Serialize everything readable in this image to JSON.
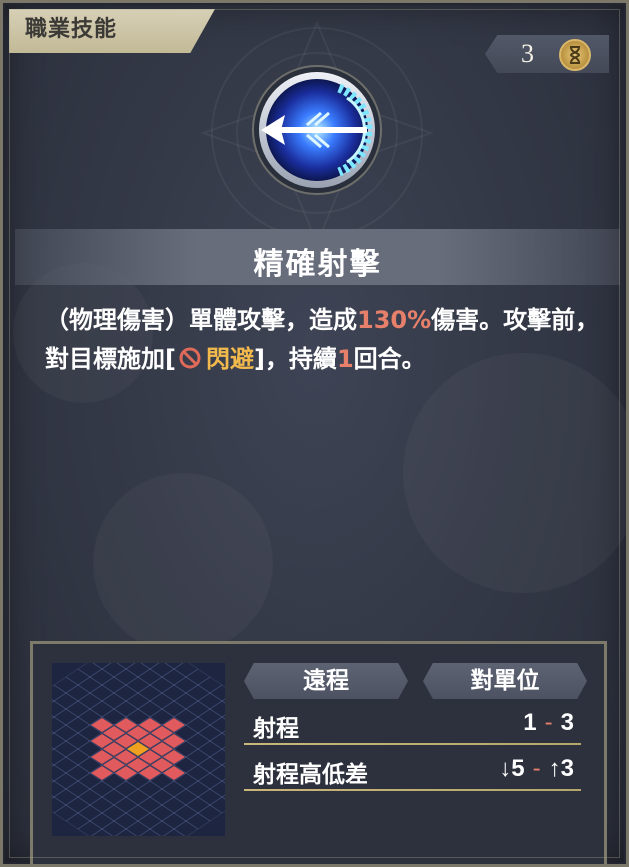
{
  "header": {
    "tab_label": "職業技能",
    "counter_value": "3",
    "counter_icon": "hourglass-icon"
  },
  "skill": {
    "icon": "piercing-arrow-skill-icon",
    "name": "精確射擊",
    "description": {
      "part1": "（物理傷害）單體攻擊，造成",
      "damage_pct": "130%",
      "part2": "傷害。攻擊前，對目標施加[",
      "status_icon": "ban-icon",
      "status_name": "閃避",
      "part3": "]，持續",
      "duration": "1",
      "part4": "回合。"
    }
  },
  "info": {
    "attack_type": "遠程",
    "target_type": "對單位",
    "range_label": "射程",
    "range_min": "1",
    "range_sep": "-",
    "range_max": "3",
    "height_label": "射程高低差",
    "height_down": "5",
    "height_sep": "-",
    "height_up": "3"
  },
  "colors": {
    "highlight_red": "#e6806a",
    "highlight_gold": "#f2b94c",
    "tab_bg": "#c9c0a0",
    "grid_tile": "#e05a5e",
    "grid_center": "#f0a020"
  }
}
